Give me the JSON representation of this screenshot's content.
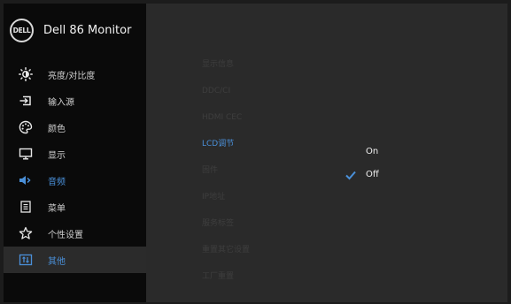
{
  "header": {
    "logo_text": "DELL",
    "model": "Dell 86 Monitor"
  },
  "menu": [
    {
      "label": "亮度/对比度",
      "icon": "brightness-icon"
    },
    {
      "label": "输入源",
      "icon": "input-source-icon"
    },
    {
      "label": "颜色",
      "icon": "palette-icon"
    },
    {
      "label": "显示",
      "icon": "display-icon"
    },
    {
      "label": "音频",
      "icon": "speaker-icon"
    },
    {
      "label": "菜单",
      "icon": "menu-icon"
    },
    {
      "label": "个性设置",
      "icon": "star-icon"
    },
    {
      "label": "其他",
      "icon": "other-icon"
    }
  ],
  "active_menu": "其他",
  "submenu": [
    {
      "label": "显示信息"
    },
    {
      "label": "DDC/CI"
    },
    {
      "label": "HDMI CEC"
    },
    {
      "label": "LCD调节"
    },
    {
      "label": "固件"
    },
    {
      "label": "IP地址"
    },
    {
      "label": "服务标签"
    },
    {
      "label": "重置其它设置"
    },
    {
      "label": "工厂重置"
    }
  ],
  "selected_submenu": "LCD调节",
  "options": {
    "on": "On",
    "off": "Off",
    "selected": "Off"
  },
  "colors": {
    "accent": "#4a90d9",
    "sidebar_bg": "#0a0a0a",
    "content_bg": "#2a2a2a",
    "dim_text": "#3e3e3e"
  }
}
